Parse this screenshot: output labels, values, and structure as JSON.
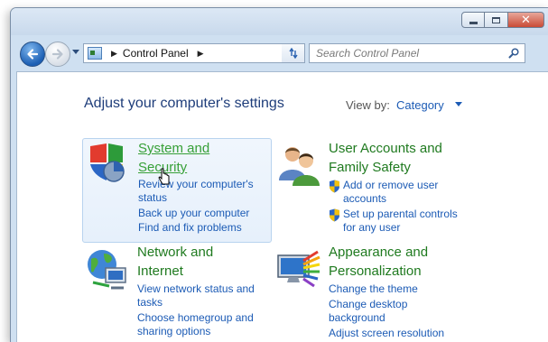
{
  "window": {
    "caption_buttons": [
      "minimize",
      "maximize",
      "close"
    ],
    "close_glyph": "✕"
  },
  "toolbar": {
    "breadcrumb": "Control Panel",
    "search_placeholder": "Search Control Panel"
  },
  "header": {
    "title": "Adjust your computer's settings",
    "view_by_label": "View by:",
    "view_by_value": "Category"
  },
  "categories": [
    {
      "title_line1": "System and",
      "title_line2": "Security",
      "icon": "shield-pie-chart-icon",
      "links": [
        {
          "line1": "Review your computer's",
          "line2": "status"
        },
        {
          "line1": "Back up your computer"
        },
        {
          "line1": "Find and fix problems"
        }
      ]
    },
    {
      "title_line1": "User Accounts and",
      "title_line2": "Family Safety",
      "icon": "users-icon",
      "links": [
        {
          "line1": "Add or remove user",
          "line2": "accounts",
          "shield": true
        },
        {
          "line1": "Set up parental controls",
          "line2": "for any user",
          "shield": true
        }
      ]
    },
    {
      "title_line1": "Network and",
      "title_line2": "Internet",
      "icon": "network-globe-icon",
      "links": [
        {
          "line1": "View network status and",
          "line2": "tasks"
        },
        {
          "line1": "Choose homegroup and",
          "line2": "sharing options"
        }
      ]
    },
    {
      "title_line1": "Appearance and",
      "title_line2": "Personalization",
      "icon": "monitor-palette-icon",
      "links": [
        {
          "line1": "Change the theme"
        },
        {
          "line1": "Change desktop",
          "line2": "background"
        },
        {
          "line1": "Adjust screen resolution"
        }
      ]
    }
  ],
  "colors": {
    "link": "#1c5bb5",
    "category_title": "#1f7a1f",
    "page_title": "#1e3d7a"
  }
}
